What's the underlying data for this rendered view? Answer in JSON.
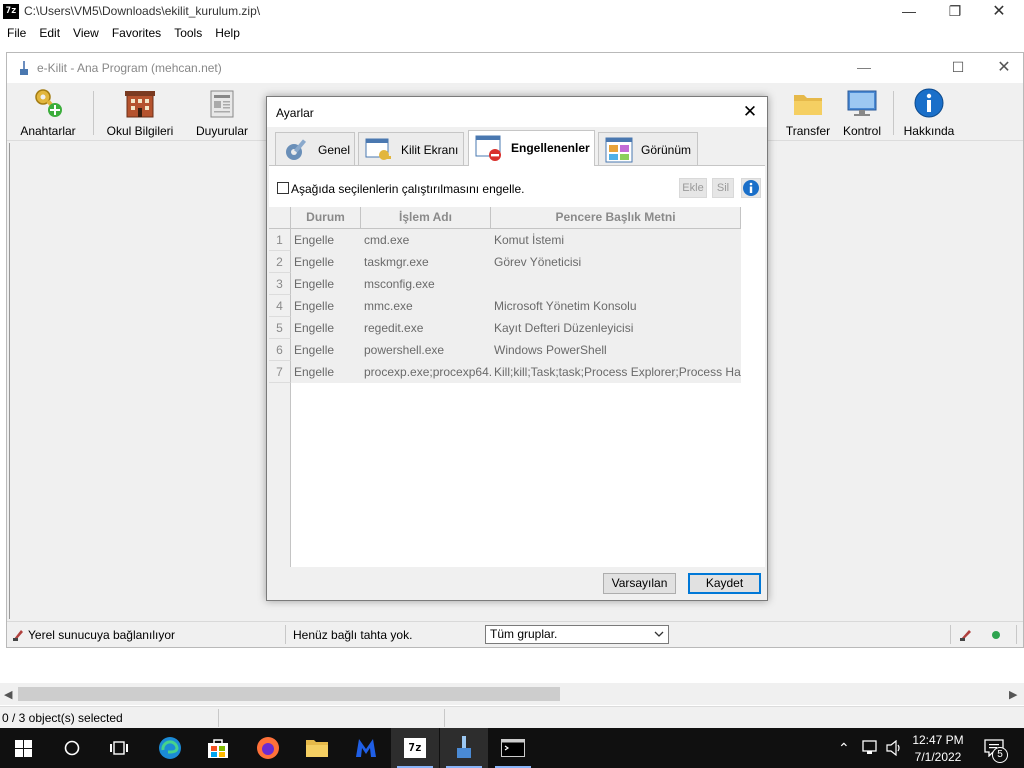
{
  "zip": {
    "title": "C:\\Users\\VM5\\Downloads\\ekilit_kurulum.zip\\",
    "logo": "7z",
    "menu": [
      "File",
      "Edit",
      "View",
      "Favorites",
      "Tools",
      "Help"
    ],
    "status": "0 / 3 object(s) selected"
  },
  "ekilit": {
    "title": "e-Kilit - Ana Program (mehcan.net)",
    "toolbar": {
      "left": [
        "Anahtarlar",
        "Okul Bilgileri",
        "Duyurular"
      ],
      "right": [
        "Transfer",
        "Kontrol",
        "Hakkında"
      ]
    },
    "status": {
      "connection": "Yerel sunucuya bağlanılıyor",
      "boards": "Henüz bağlı tahta yok.",
      "group": "Tüm gruplar."
    }
  },
  "dialog": {
    "title": "Ayarlar",
    "tabs": [
      "Genel",
      "Kilit Ekranı",
      "Engellenenler",
      "Görünüm"
    ],
    "active_tab": "Engellenenler",
    "checkbox_label": "Aşağıda seçilenlerin çalıştırılmasını engelle.",
    "checkbox_checked": false,
    "add_label": "Ekle",
    "delete_label": "Sil",
    "columns": [
      "Durum",
      "İşlem Adı",
      "Pencere Başlık Metni"
    ],
    "rows": [
      {
        "n": "1",
        "status": "Engelle",
        "process": "cmd.exe",
        "window": "Komut İstemi"
      },
      {
        "n": "2",
        "status": "Engelle",
        "process": "taskmgr.exe",
        "window": "Görev Yöneticisi"
      },
      {
        "n": "3",
        "status": "Engelle",
        "process": "msconfig.exe",
        "window": ""
      },
      {
        "n": "4",
        "status": "Engelle",
        "process": "mmc.exe",
        "window": "Microsoft Yönetim Konsolu"
      },
      {
        "n": "5",
        "status": "Engelle",
        "process": "regedit.exe",
        "window": "Kayıt Defteri Düzenleyicisi"
      },
      {
        "n": "6",
        "status": "Engelle",
        "process": "powershell.exe",
        "window": "Windows PowerShell"
      },
      {
        "n": "7",
        "status": "Engelle",
        "process": "procexp.exe;procexp64.",
        "window": "Kill;kill;Task;task;Process Explorer;Process Hack"
      }
    ],
    "defaults_label": "Varsayılan",
    "save_label": "Kaydet"
  },
  "taskbar": {
    "time": "12:47 PM",
    "date": "7/1/2022",
    "notification_count": "5",
    "app_7zip_label": "7z"
  },
  "colors": {
    "accent": "#0078d7",
    "taskbar": "#101010",
    "info_blue": "#1a6fc9",
    "status_green": "#2ea44f"
  }
}
